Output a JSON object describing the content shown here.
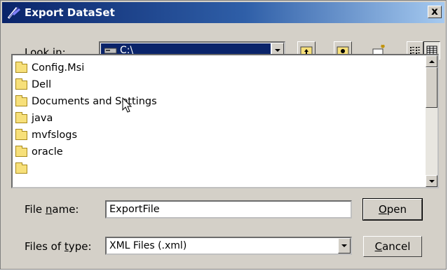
{
  "window": {
    "title": "Export DataSet",
    "close_label": "x"
  },
  "look_in": {
    "label": "Look in:",
    "mnemonic": "i",
    "value": "C:\\",
    "drive_icon": "drive-icon"
  },
  "toolbar": [
    {
      "name": "up-folder-button",
      "icon": "up-folder-icon"
    },
    {
      "name": "home-button",
      "icon": "home-folder-icon"
    },
    {
      "name": "new-folder-button",
      "icon": "new-folder-icon"
    },
    {
      "name": "list-view-button",
      "icon": "list-view-icon"
    },
    {
      "name": "details-view-button",
      "icon": "details-view-icon"
    }
  ],
  "files": [
    {
      "name": "Config.Msi",
      "icon": "folder-icon"
    },
    {
      "name": "Dell",
      "icon": "folder-icon"
    },
    {
      "name": "Documents and Settings",
      "icon": "folder-icon"
    },
    {
      "name": "java",
      "icon": "folder-icon"
    },
    {
      "name": "mvfslogs",
      "icon": "folder-icon"
    },
    {
      "name": "oracle",
      "icon": "folder-icon"
    }
  ],
  "file_name": {
    "label": "File name:",
    "value": "ExportFile"
  },
  "file_type": {
    "label": "Files of type:",
    "value": "XML Files (.xml)"
  },
  "buttons": {
    "open": "Open",
    "cancel": "Cancel"
  },
  "colors": {
    "title_bar": "#0a246a",
    "dialog_bg": "#d4d0c8",
    "combo_highlight": "#0a246a"
  }
}
